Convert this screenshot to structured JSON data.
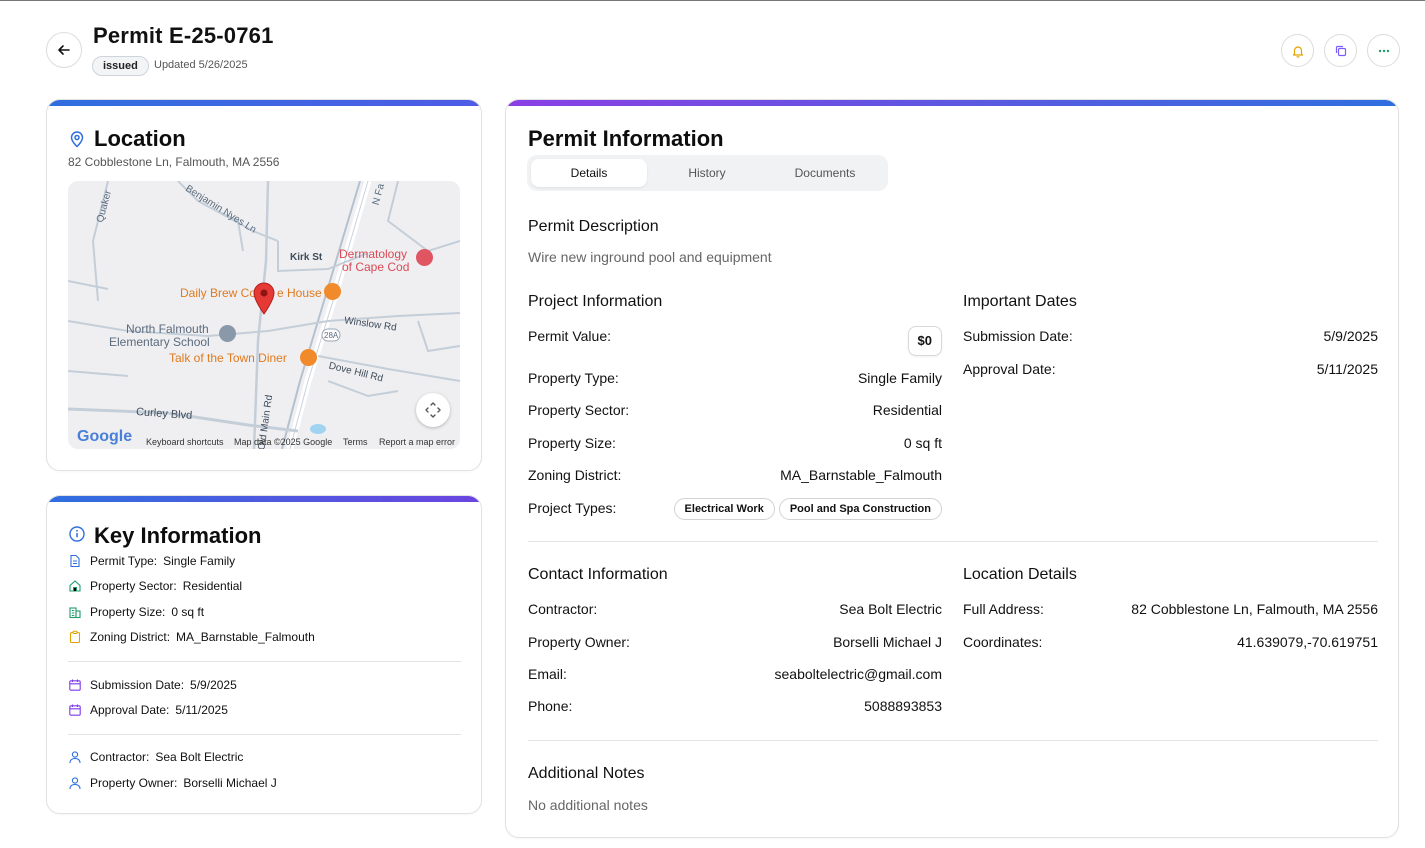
{
  "header": {
    "title": "Permit E-25-0761",
    "status": "issued",
    "updated": "Updated 5/26/2025",
    "icons": [
      "back-arrow-icon",
      "bell-icon",
      "copy-icon",
      "more-horizontal-icon"
    ]
  },
  "location": {
    "title": "Location",
    "address": "82 Cobblestone Ln, Falmouth, MA 2556",
    "map": {
      "streets": [
        "Quaker",
        "Benjamin Nyes Ln",
        "Kirk St",
        "N Fa",
        "Winslow Rd",
        "Dove Hill Rd",
        "Curley Blvd",
        "Old Main Rd",
        "28A"
      ],
      "pois": [
        "Dermatology",
        "of Cape Cod",
        "Daily Brew Co",
        "e House",
        "North Falmouth",
        "Elementary School",
        "Talk of the Town Diner"
      ],
      "logo": "Google",
      "footer": [
        "Keyboard shortcuts",
        "Map data ©2025 Google",
        "Terms",
        "Report a map error"
      ]
    }
  },
  "key_info": {
    "title": "Key Information",
    "rows": [
      {
        "label": "Permit Type:",
        "value": "Single Family"
      },
      {
        "label": "Property Sector:",
        "value": "Residential"
      },
      {
        "label": "Property Size:",
        "value": "0 sq ft"
      },
      {
        "label": "Zoning District:",
        "value": "MA_Barnstable_Falmouth"
      },
      {
        "label": "Submission Date:",
        "value": "5/9/2025"
      },
      {
        "label": "Approval Date:",
        "value": "5/11/2025"
      },
      {
        "label": "Contractor:",
        "value": "Sea Bolt Electric"
      },
      {
        "label": "Property Owner:",
        "value": "Borselli Michael J"
      }
    ]
  },
  "permit_info": {
    "title": "Permit Information",
    "tabs": [
      "Details",
      "History",
      "Documents"
    ],
    "description_title": "Permit Description",
    "description": "Wire new inground pool and equipment",
    "project": {
      "title": "Project Information",
      "permit_value_label": "Permit Value:",
      "permit_value": "$0",
      "rows": [
        {
          "label": "Property Type:",
          "value": "Single Family"
        },
        {
          "label": "Property Sector:",
          "value": "Residential"
        },
        {
          "label": "Property Size:",
          "value": "0 sq ft"
        },
        {
          "label": "Zoning District:",
          "value": "MA_Barnstable_Falmouth"
        }
      ],
      "project_types_label": "Project Types:",
      "project_types": [
        "Electrical Work",
        "Pool and Spa Construction"
      ]
    },
    "dates": {
      "title": "Important Dates",
      "rows": [
        {
          "label": "Submission Date:",
          "value": "5/9/2025"
        },
        {
          "label": "Approval Date:",
          "value": "5/11/2025"
        }
      ]
    },
    "contact": {
      "title": "Contact Information",
      "rows": [
        {
          "label": "Contractor:",
          "value": "Sea Bolt Electric"
        },
        {
          "label": "Property Owner:",
          "value": "Borselli Michael J"
        },
        {
          "label": "Email:",
          "value": "seaboltelectric@gmail.com"
        },
        {
          "label": "Phone:",
          "value": "5088893853"
        }
      ]
    },
    "location_details": {
      "title": "Location Details",
      "rows": [
        {
          "label": "Full Address:",
          "value": "82 Cobblestone Ln, Falmouth, MA 2556"
        },
        {
          "label": "Coordinates:",
          "value": "41.639079,-70.619751"
        }
      ]
    },
    "notes": {
      "title": "Additional Notes",
      "text": "No additional notes"
    }
  },
  "colors": {
    "accent_blue": "#2f6fdf",
    "accent_purple": "#7c3aed",
    "bell": "#e2a300",
    "copy": "#7c5cff",
    "more": "#1f9d6b"
  }
}
